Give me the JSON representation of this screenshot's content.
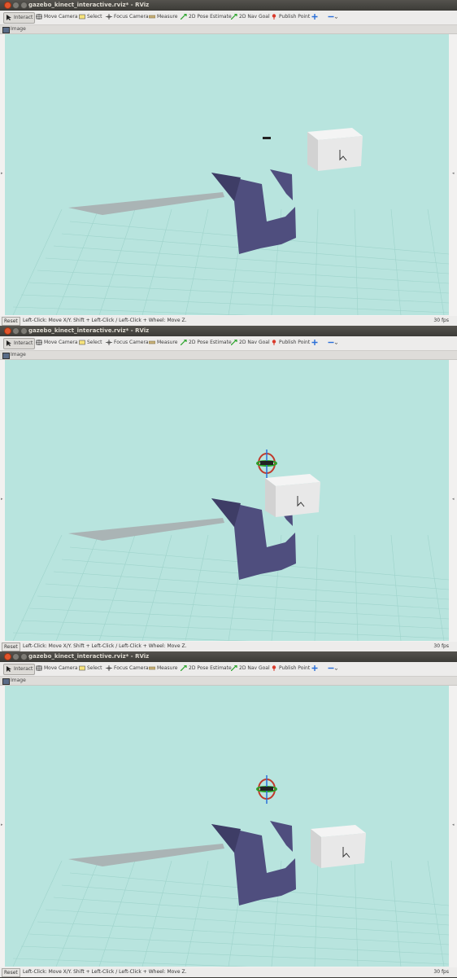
{
  "window": {
    "title": "gazebo_kinect_interactive.rviz* - RViz"
  },
  "toolbar": {
    "interact": "Interact",
    "move_camera": "Move Camera",
    "select": "Select",
    "focus_camera": "Focus Camera",
    "measure": "Measure",
    "pose_estimate": "2D Pose Estimate",
    "nav_goal": "2D Nav Goal",
    "publish_point": "Publish Point"
  },
  "panel": {
    "title": "Image"
  },
  "status": {
    "reset": "Reset",
    "hint": "Left-Click: Move X/Y. Shift + Left-Click / Left-Click + Wheel: Move Z.",
    "fps": "30 fps"
  },
  "colors": {
    "viewport_bg": "#b8e4de",
    "object": "#4f4e7e",
    "box": "#e8e8e8"
  },
  "icons": {
    "interact": "cursor-icon",
    "move_camera": "camera-move-icon",
    "select": "select-rect-icon",
    "focus_camera": "focus-icon",
    "measure": "ruler-icon",
    "pose_estimate": "green-arrow-icon",
    "nav_goal": "green-arrow-icon",
    "publish_point": "red-pin-icon"
  }
}
